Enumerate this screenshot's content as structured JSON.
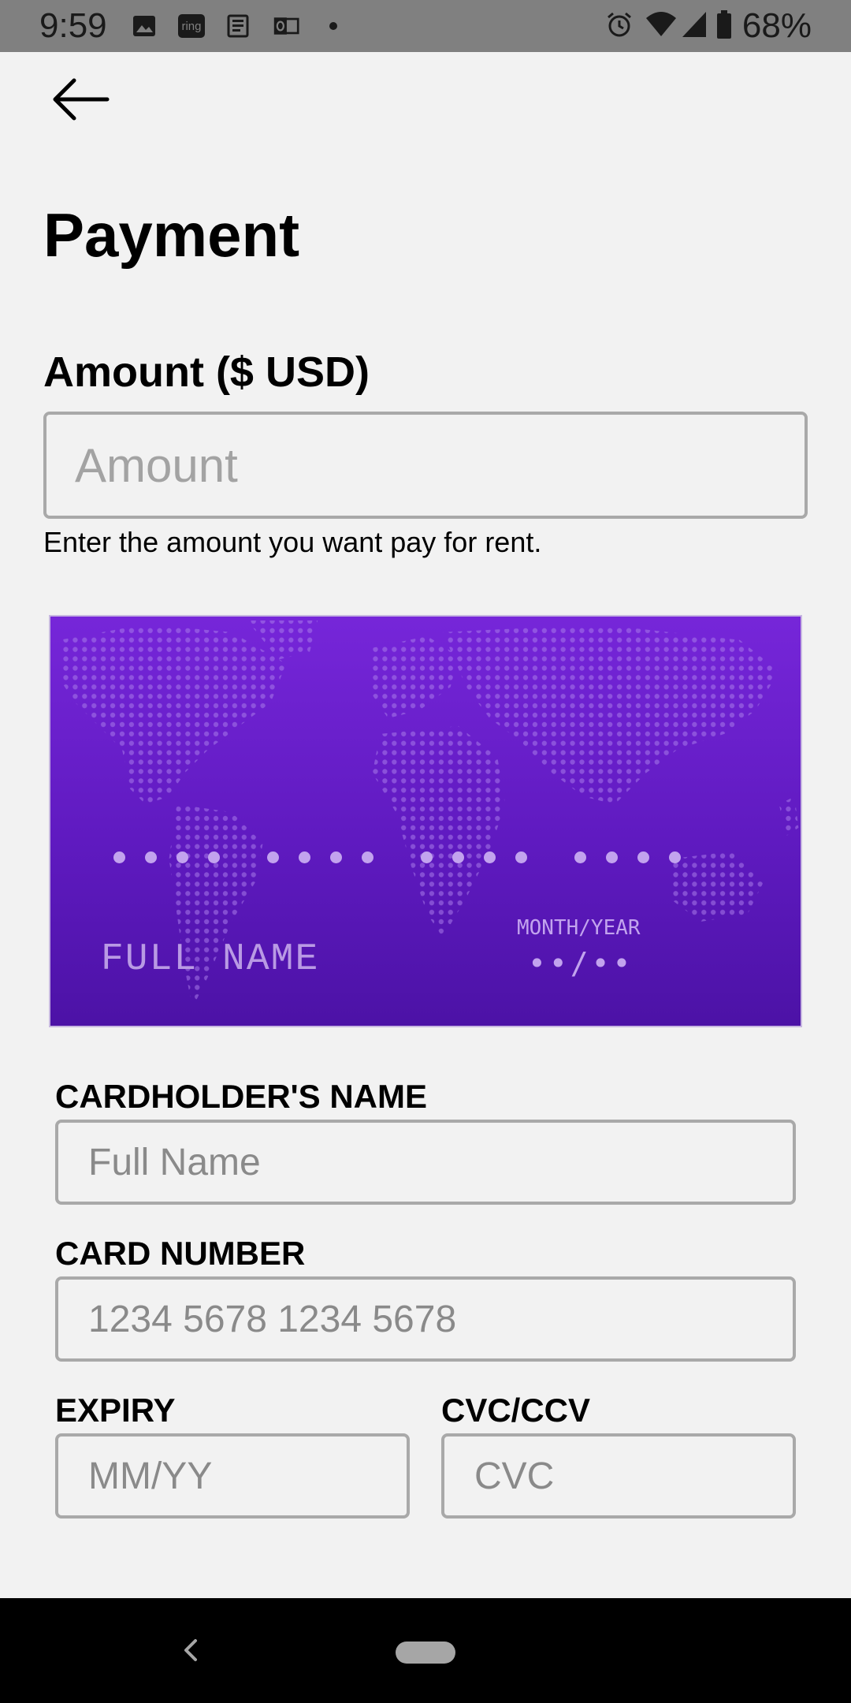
{
  "status_bar": {
    "time": "9:59",
    "notification_icons": [
      "image-icon",
      "ring-icon",
      "news-icon",
      "outlook-icon",
      "dot-icon"
    ],
    "ring_text": "ring",
    "right_icons": [
      "alarm-icon",
      "wifi-icon",
      "signal-icon",
      "battery-icon"
    ],
    "battery": "68%"
  },
  "header": {
    "back_icon": "arrow-left-icon",
    "title": "Payment"
  },
  "amount": {
    "label": "Amount ($ USD)",
    "placeholder": "Amount",
    "help": "Enter the amount you want pay for rent."
  },
  "card_preview": {
    "background_color": "#6a1fd0",
    "number_groups": 4,
    "name": "FULL NAME",
    "expiry_label": "MONTH/YEAR",
    "expiry_value": "••/••"
  },
  "form": {
    "cardholder_label": "CARDHOLDER'S NAME",
    "cardholder_placeholder": "Full Name",
    "card_number_label": "CARD NUMBER",
    "card_number_placeholder": "1234 5678 1234 5678",
    "expiry_label": "EXPIRY",
    "expiry_placeholder": "MM/YY",
    "cvc_label": "CVC/CCV",
    "cvc_placeholder": "CVC"
  },
  "nav_bar": {
    "back_icon": "nav-back-icon",
    "home_icon": "home-pill-icon"
  }
}
